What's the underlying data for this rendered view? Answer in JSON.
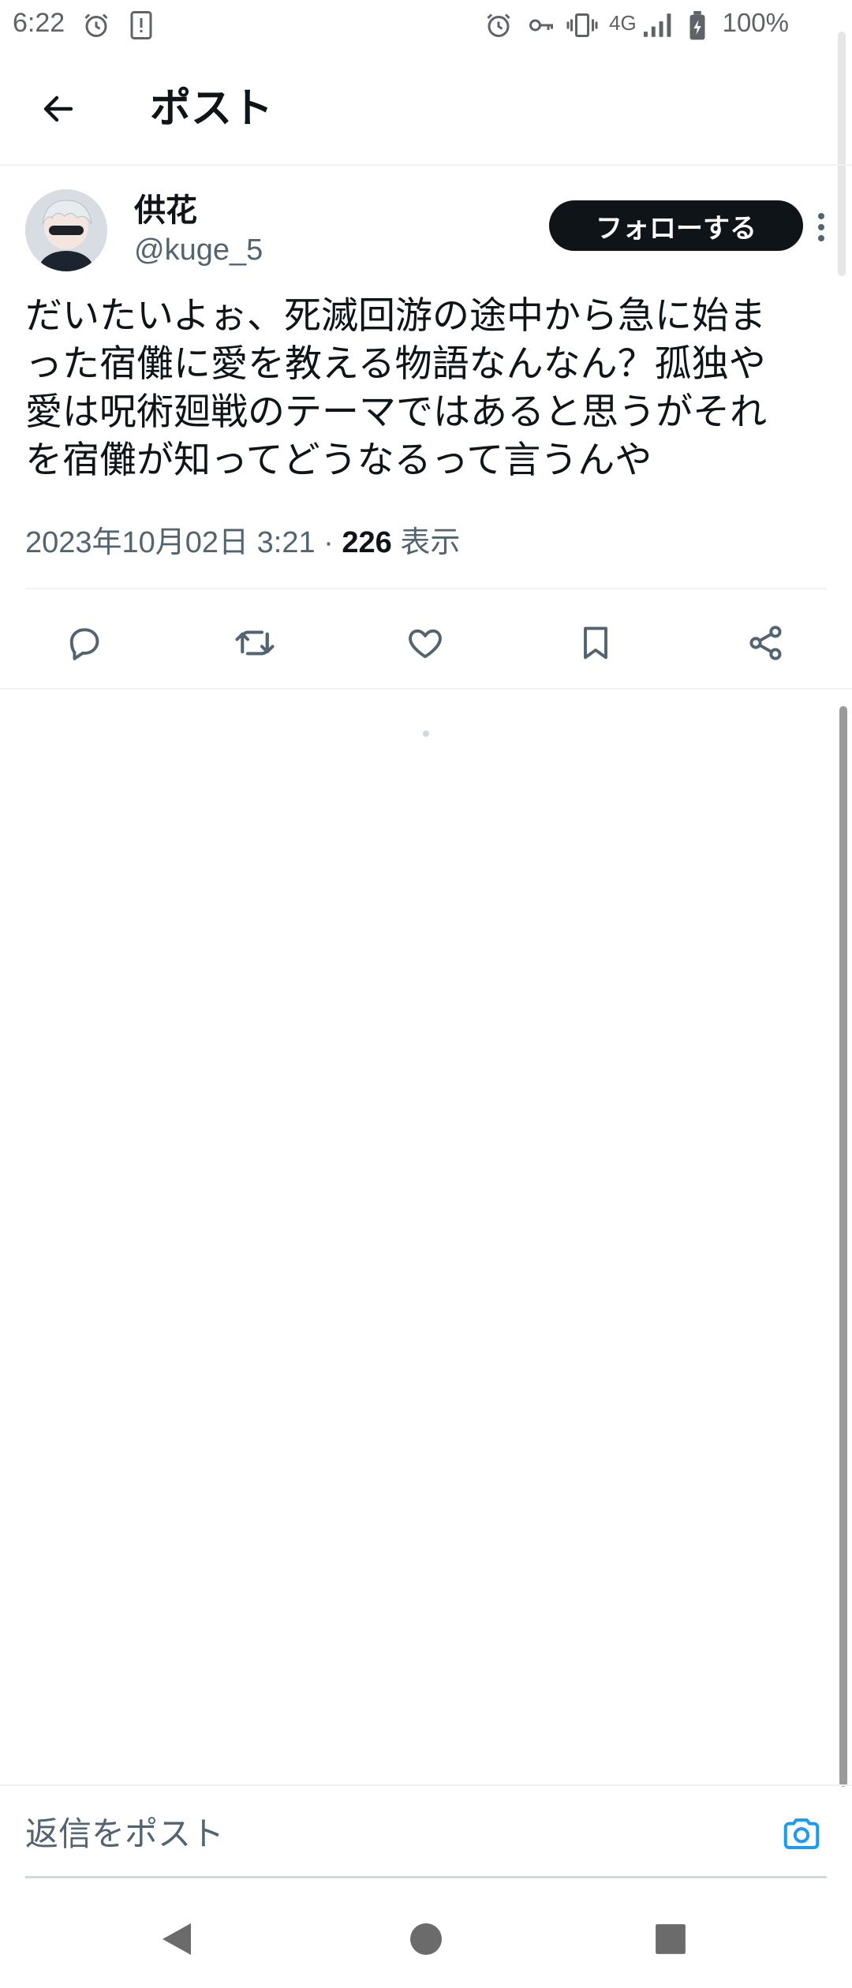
{
  "status_bar": {
    "time": "6:22",
    "network": "4G",
    "battery": "100%"
  },
  "header": {
    "title": "ポスト"
  },
  "post": {
    "author_name": "供花",
    "author_handle": "@kuge_5",
    "follow_label": "フォローする",
    "text_lines": [
      "だいたいよぉ、死滅回游の途中から急に始ま",
      "った宿儺に愛を教える物語なんなん？孤独や",
      "愛は呪術廻戦のテーマではあると思うがそれ",
      "を宿儺が知ってどうなるって言うんや"
    ],
    "timestamp": "2023年10月02日 3:21",
    "separator": " · ",
    "views_count": "226",
    "views_label": " 表示"
  },
  "reply": {
    "placeholder": "返信をポスト"
  },
  "colors": {
    "accent": "#1d9bf0",
    "text": "#0f1419",
    "secondary": "#536471",
    "divider": "#eff3f4"
  },
  "icons": {
    "reply": "reply-icon",
    "retweet": "retweet-icon",
    "like": "heart-icon",
    "bookmark": "bookmark-icon",
    "share": "share-icon",
    "camera": "camera-icon"
  }
}
